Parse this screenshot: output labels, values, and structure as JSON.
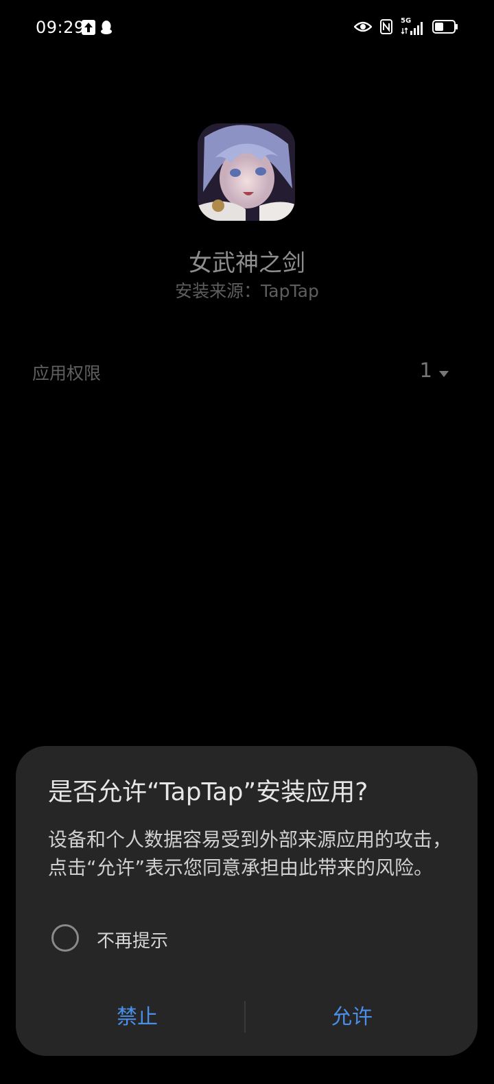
{
  "status_bar": {
    "time": "09:29",
    "left_icons": [
      "upload-icon",
      "qq-penguin-icon"
    ],
    "right_icons": [
      "eye-icon",
      "nfc-icon",
      "5g-signal-icon",
      "battery-icon"
    ],
    "network_label": "5G"
  },
  "app": {
    "name": "女武神之剑",
    "install_source": "安装来源：TapTap"
  },
  "permissions": {
    "label": "应用权限",
    "count": "1"
  },
  "dialog": {
    "title": "是否允许“TapTap”安装应用?",
    "message": "设备和个人数据容易受到外部来源应用的攻击，点击“允许”表示您同意承担由此带来的风险。",
    "checkbox_label": "不再提示",
    "deny_label": "禁止",
    "allow_label": "允许",
    "accent_color": "#4b8fe8"
  }
}
